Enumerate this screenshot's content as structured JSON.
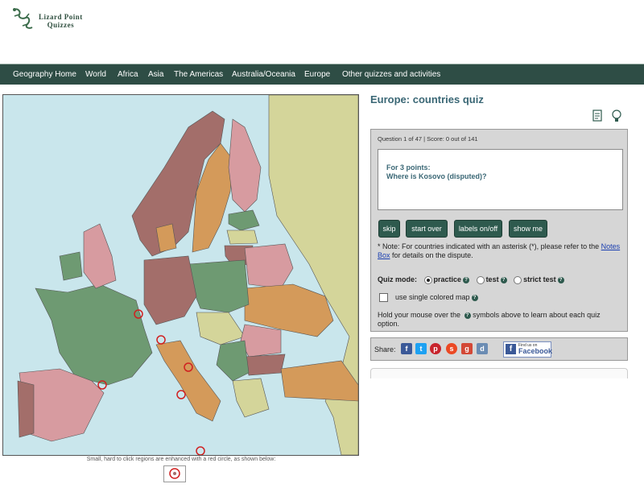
{
  "header": {
    "logo_text_line1": "Lizard Point",
    "logo_text_line2": "Quizzes"
  },
  "nav": {
    "items": [
      "Geography Home",
      "World",
      "Africa",
      "Asia",
      "The Americas",
      "Australia/Oceania",
      "Europe",
      "Other quizzes and activities"
    ]
  },
  "quiz": {
    "title": "Europe: countries quiz",
    "icons": [
      "notes-icon",
      "lightbulb-icon"
    ]
  },
  "panel": {
    "status": "Question 1 of 47 | Score: 0 out of 141",
    "question_points": "For 3 points:",
    "question_text": "Where is Kosovo (disputed)?",
    "buttons": [
      "skip",
      "start over",
      "labels on/off",
      "show me"
    ],
    "note_before": "* Note: For countries indicated with an asterisk (*), please refer to the ",
    "note_link": "Notes Box",
    "note_after": " for details on the dispute.",
    "mode_label": "Quiz mode:",
    "mode_options": [
      "practice",
      "test",
      "strict test"
    ],
    "mode_selected": "practice",
    "single_color_label": "use single colored map",
    "hover_before": "Hold your mouse over the ",
    "hover_after": " symbols above to learn about each quiz option."
  },
  "share": {
    "label": "Share:",
    "fb_small": "Find us on",
    "fb_big": "Facebook"
  },
  "map": {
    "caption": "Small, hard to click regions are enhanced with a red circle, as shown below:"
  },
  "colors": {
    "nav_bg": "#2e4d45",
    "button_bg": "#2e5a4e",
    "title": "#3a6775",
    "sea": "#c9e6ec"
  }
}
